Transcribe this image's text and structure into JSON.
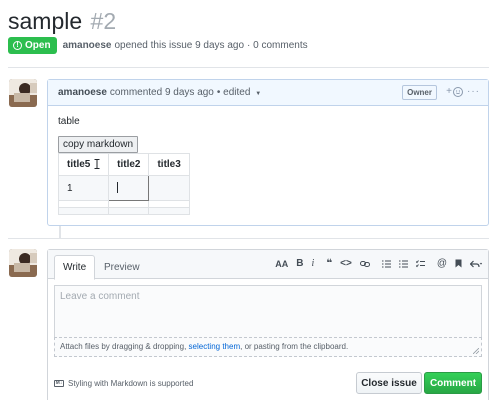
{
  "issue": {
    "title": "sample",
    "number": "#2",
    "state": "Open",
    "author": "amanoese",
    "opened_text": "opened this issue 9 days ago",
    "comments_count": "· 0 comments"
  },
  "comment": {
    "author": "amanoese",
    "action": "commented 9 days ago",
    "edited": "• edited",
    "owner_badge": "Owner",
    "emoji_plus": "+",
    "more": "···",
    "body_text": "table",
    "copy_button": "copy markdown",
    "table": {
      "headers": [
        "title5",
        "title2",
        "title3"
      ],
      "rows": [
        [
          "1",
          "",
          ""
        ]
      ]
    }
  },
  "editor": {
    "tabs": [
      "Write",
      "Preview"
    ],
    "toolbar": {
      "header": "AA",
      "bold": "B",
      "italic": "i",
      "quote": "❝",
      "code": "<>",
      "link": "🔗",
      "bullet_list": "☰",
      "numbered_list": "☷",
      "task_list": "☑",
      "mention": "@",
      "bookmark": "🔖",
      "reply": "↶"
    },
    "placeholder": "Leave a comment",
    "attach_prefix": "Attach files by dragging & dropping, ",
    "attach_link": "selecting them",
    "attach_suffix": ", or pasting from the clipboard.",
    "markdown_hint": "Styling with Markdown is supported",
    "close_button": "Close issue",
    "comment_button": "Comment"
  },
  "colors": {
    "open_green": "#2cbe4e",
    "link_blue": "#0366d6",
    "header_blue": "#f1f8ff"
  }
}
